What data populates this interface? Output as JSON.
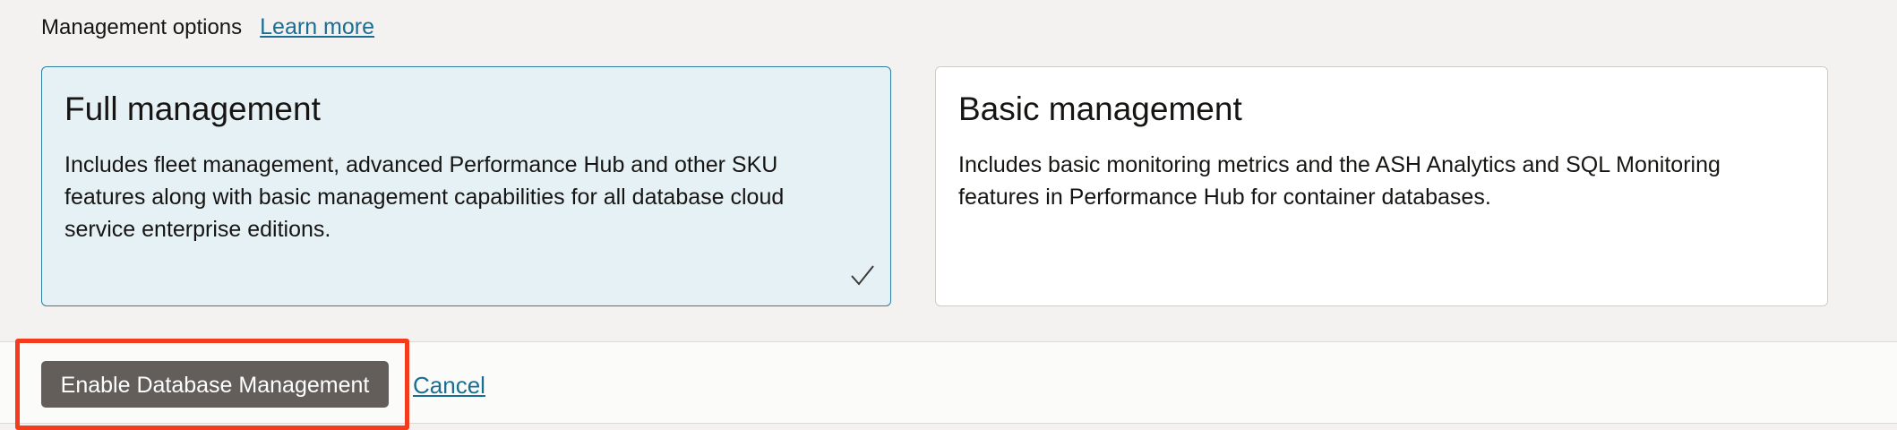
{
  "management_options": {
    "label": "Management options",
    "learn_more": "Learn more"
  },
  "cards": {
    "full": {
      "title": "Full management",
      "description": "Includes fleet management, advanced Performance Hub and other SKU features along with basic management capabilities for all database cloud service enterprise editions.",
      "selected": true,
      "icon": "checkmark-icon"
    },
    "basic": {
      "title": "Basic management",
      "description": "Includes basic monitoring metrics and the ASH Analytics and SQL Monitoring features in Performance Hub for container databases.",
      "selected": false
    }
  },
  "footer": {
    "enable_label": "Enable Database Management",
    "cancel_label": "Cancel"
  },
  "colors": {
    "selected_card_bg": "#e6f1f5",
    "selected_card_border": "#2f7fa0",
    "primary_button": "#645e5a",
    "link": "#1b6e93",
    "highlight": "#f43b1c"
  }
}
